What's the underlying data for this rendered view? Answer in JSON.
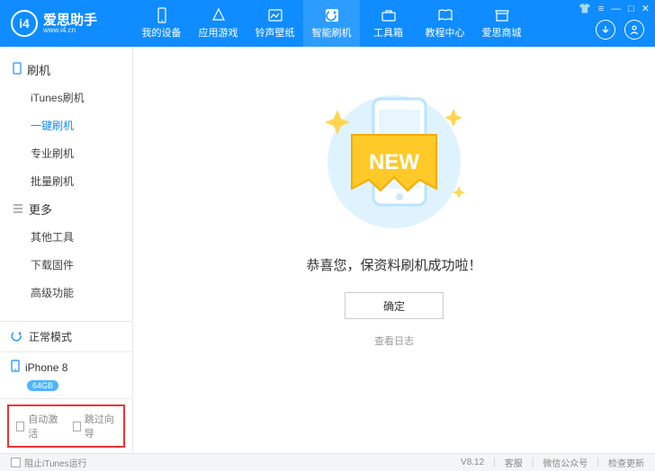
{
  "logo": {
    "mark": "i4",
    "title": "爱思助手",
    "url": "www.i4.cn"
  },
  "nav": [
    {
      "label": "我的设备"
    },
    {
      "label": "应用游戏"
    },
    {
      "label": "铃声壁纸"
    },
    {
      "label": "智能刷机"
    },
    {
      "label": "工具箱"
    },
    {
      "label": "教程中心"
    },
    {
      "label": "爱思商城"
    }
  ],
  "sidebar": {
    "flash": {
      "title": "刷机",
      "items": [
        "iTunes刷机",
        "一键刷机",
        "专业刷机",
        "批量刷机"
      ]
    },
    "more": {
      "title": "更多",
      "items": [
        "其他工具",
        "下载固件",
        "高级功能"
      ]
    },
    "status_label": "正常模式",
    "device": {
      "name": "iPhone 8",
      "storage": "64GB"
    },
    "auto_activate": "自动激活",
    "skip_wizard": "跳过向导"
  },
  "main": {
    "new_badge": "NEW",
    "message": "恭喜您，保资料刷机成功啦！",
    "ok": "确定",
    "view_log": "查看日志"
  },
  "footer": {
    "block_itunes": "阻止iTunes运行",
    "version": "V8.12",
    "support": "客服",
    "wechat": "微信公众号",
    "update": "检查更新"
  }
}
